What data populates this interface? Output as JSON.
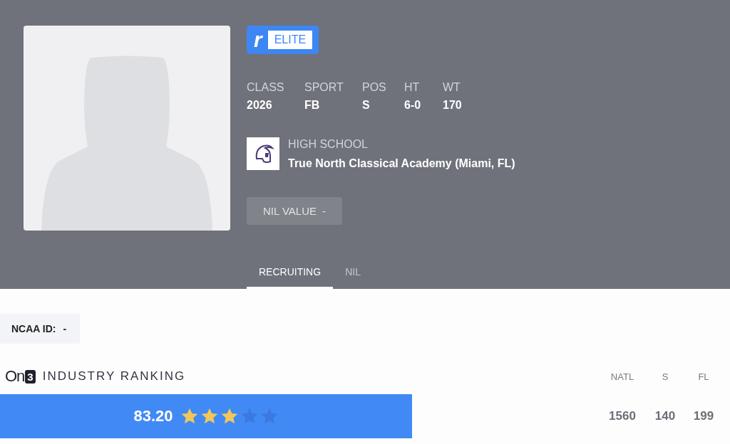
{
  "badge": {
    "logo_letter": "r",
    "label": "ELITE"
  },
  "stats": [
    {
      "label": "CLASS",
      "value": "2026"
    },
    {
      "label": "SPORT",
      "value": "FB"
    },
    {
      "label": "POS",
      "value": "S"
    },
    {
      "label": "HT",
      "value": "6-0"
    },
    {
      "label": "WT",
      "value": "170"
    }
  ],
  "school": {
    "label": "HIGH SCHOOL",
    "name": "True North Classical Academy (Miami, FL)"
  },
  "nil_value": {
    "label": "NIL VALUE",
    "value": "-"
  },
  "tabs": [
    {
      "label": "RECRUITING",
      "selected": true
    },
    {
      "label": "NIL",
      "selected": false
    }
  ],
  "ncaa_id": {
    "label": "NCAA ID:",
    "value": "-"
  },
  "ranking": {
    "brand": "On",
    "brand_digit": "3",
    "title": "INDUSTRY RANKING",
    "score": "83.20",
    "stars": 3,
    "columns": [
      {
        "label": "NATL",
        "value": "1560"
      },
      {
        "label": "S",
        "value": "140"
      },
      {
        "label": "FL",
        "value": "199"
      }
    ]
  }
}
